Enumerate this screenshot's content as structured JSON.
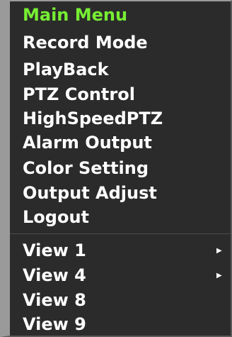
{
  "menu": {
    "title": "Main Menu",
    "items": [
      "Record Mode",
      "PlayBack",
      "PTZ Control",
      "HighSpeedPTZ",
      "Alarm Output",
      "Color Setting",
      "Output Adjust",
      "Logout"
    ],
    "view_items": [
      {
        "label": "View 1",
        "has_submenu": true
      },
      {
        "label": "View 4",
        "has_submenu": true
      },
      {
        "label": "View 8",
        "has_submenu": false
      },
      {
        "label": "View 9",
        "has_submenu": false
      }
    ],
    "submenu_arrow_icon": "triangle-right-icon",
    "colors": {
      "highlight": "#77ee33",
      "text": "#ffffff",
      "background": "#2b2b2b",
      "left_bar": "#9a9a9a"
    }
  }
}
